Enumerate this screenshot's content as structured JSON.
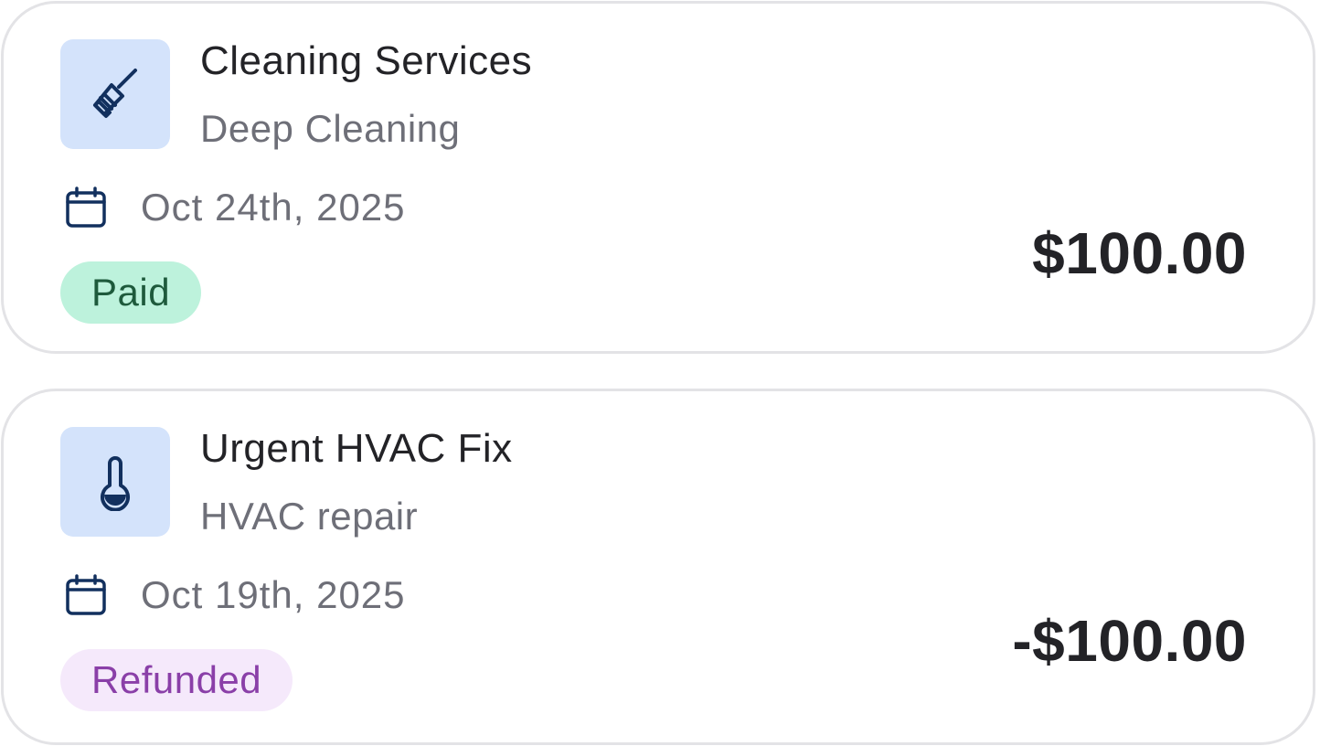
{
  "transactions": [
    {
      "icon": "broom-icon",
      "title": "Cleaning Services",
      "subtitle": "Deep Cleaning",
      "date_icon": "calendar-icon",
      "date": "Oct 24th, 2025",
      "status": "Paid",
      "status_bg": "#bdf2dc",
      "status_color": "#1e5a3c",
      "amount": "$100.00"
    },
    {
      "icon": "thermometer-icon",
      "title": "Urgent HVAC Fix",
      "subtitle": "HVAC repair",
      "date_icon": "calendar-icon",
      "date": "Oct 19th, 2025",
      "status": "Refunded",
      "status_bg": "#f5e9fb",
      "status_color": "#8a3fa8",
      "amount": "-$100.00"
    }
  ],
  "colors": {
    "icon_tile_bg": "#d4e3fb",
    "icon_stroke": "#12305e",
    "card_border": "#e3e3e6",
    "title_text": "#232327",
    "muted_text": "#6e6f78"
  }
}
